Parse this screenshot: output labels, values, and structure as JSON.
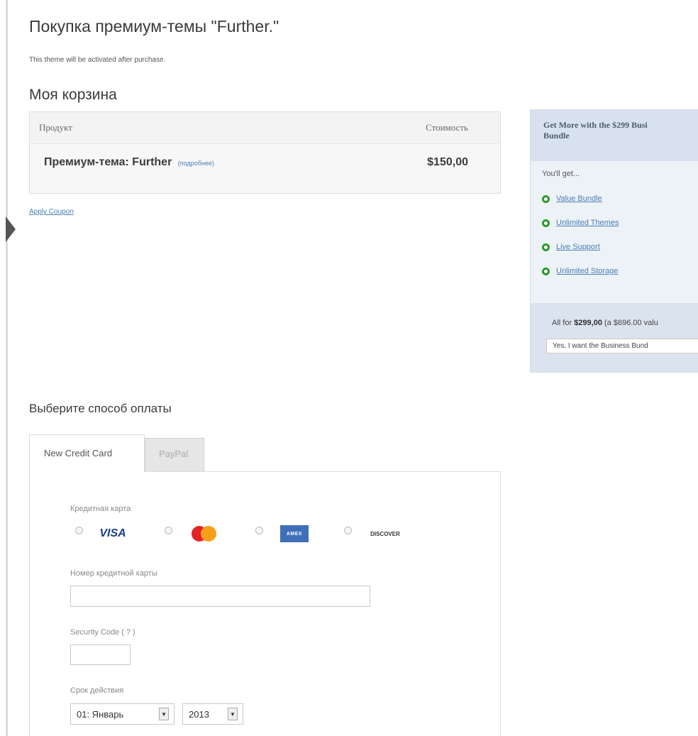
{
  "page": {
    "title": "Покупка премиум-темы \"Further.\"",
    "subtitle": "This theme will be activated after purchase."
  },
  "cart": {
    "title": "Моя корзина",
    "col_product": "Продукт",
    "col_price": "Стоимость",
    "product_name": "Премиум-тема: Further",
    "product_more": "(подробнее)",
    "product_price": "$150,00",
    "apply_coupon": "Apply Coupon"
  },
  "promo": {
    "heading_line1": "Get More with the $299 Busi",
    "heading_line2": "Bundle",
    "youll_get": "You'll get...",
    "items": [
      "Value Bundle",
      "Unlimited Themes",
      "Live Support",
      "Unlimited Storage"
    ],
    "total_prefix": "All for ",
    "total_price": "$299,00",
    "total_suffix": " (a $696.00 valu",
    "button_label": "Yes, I want the Business Bund",
    "accent_color": "#2b9a2b"
  },
  "payment": {
    "title": "Выберите способ оплаты",
    "tab_credit_card": "New Credit Card",
    "tab_paypal": "PayPal",
    "card_type_label": "Кредитная карта",
    "cards": {
      "visa": "VISA",
      "amex": "AMEX",
      "discover": "DISCOVER"
    },
    "card_number_label": "Номер кредитной карты",
    "card_number_value": "",
    "security_code_label": "Security Code ( ? )",
    "security_code_value": "",
    "expiry_label": "Срок действия",
    "expiry_month": "01: Январь",
    "expiry_year": "2013"
  }
}
